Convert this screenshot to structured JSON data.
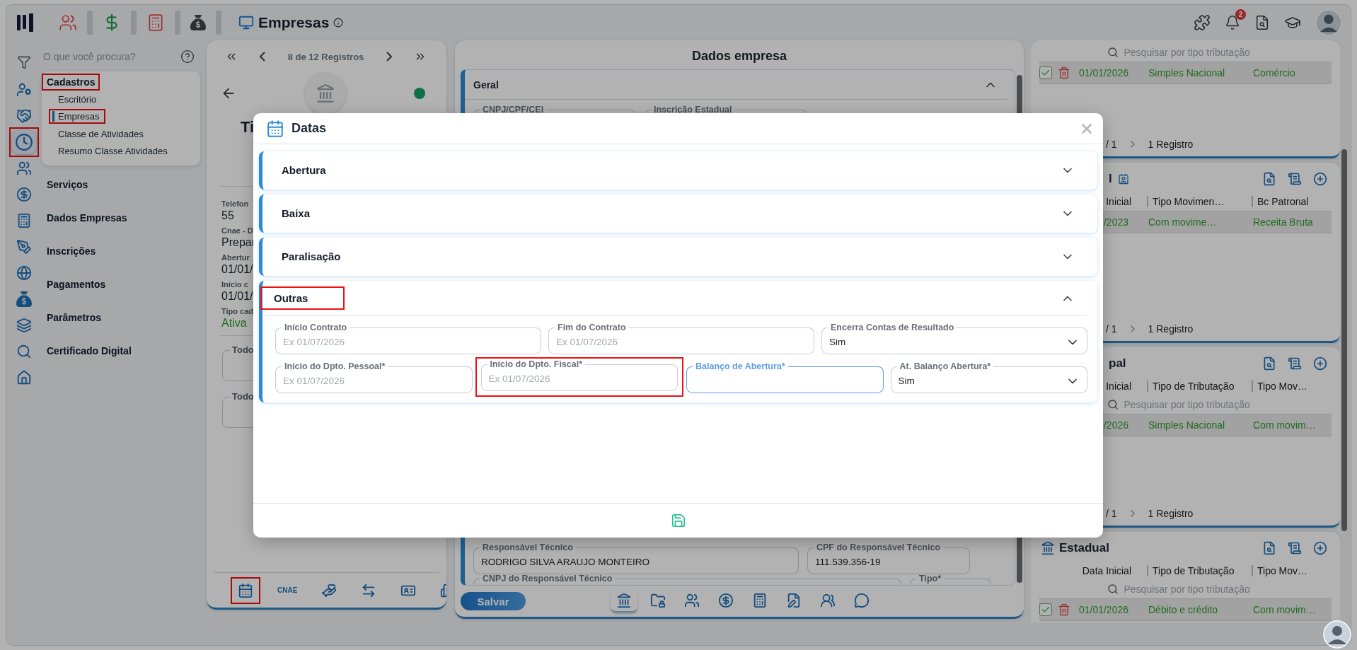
{
  "topbar": {
    "title": "Empresas",
    "notification_count": "2"
  },
  "rail": [
    {
      "kind": "user-gear",
      "selected": false,
      "highlighted": false
    },
    {
      "kind": "handshake",
      "selected": false,
      "highlighted": false
    },
    {
      "kind": "clock",
      "selected": true,
      "highlighted": true
    },
    {
      "kind": "users",
      "selected": false,
      "highlighted": false
    },
    {
      "kind": "dollar",
      "selected": false,
      "highlighted": false
    },
    {
      "kind": "calculator",
      "selected": false,
      "highlighted": false
    },
    {
      "kind": "pen",
      "selected": false,
      "highlighted": false
    },
    {
      "kind": "globe",
      "selected": false,
      "highlighted": false
    },
    {
      "kind": "money-bag",
      "selected": false,
      "highlighted": false
    },
    {
      "kind": "layers",
      "selected": false,
      "highlighted": false
    },
    {
      "kind": "search",
      "selected": false,
      "highlighted": false
    },
    {
      "kind": "home",
      "selected": false,
      "highlighted": false
    }
  ],
  "menu": {
    "search_placeholder": "O que você procura?",
    "items": [
      {
        "label": "Cadastros",
        "expanded": true,
        "highlighted": true,
        "children": [
          {
            "label": "Escritório",
            "selected": false,
            "highlighted": false
          },
          {
            "label": "Empresas",
            "selected": true,
            "highlighted": true
          },
          {
            "label": "Classe de Atividades",
            "selected": false,
            "highlighted": false
          },
          {
            "label": "Resumo Classe Atividades",
            "selected": false,
            "highlighted": false
          }
        ]
      },
      {
        "label": "Serviços",
        "expanded": false,
        "highlighted": false
      },
      {
        "label": "Dados Empresas",
        "expanded": false,
        "highlighted": false
      },
      {
        "label": "Inscrições",
        "expanded": false,
        "highlighted": false
      },
      {
        "label": "Pagamentos",
        "expanded": false,
        "highlighted": false
      },
      {
        "label": "Parâmetros",
        "expanded": false,
        "highlighted": false
      },
      {
        "label": "Certificado Digital",
        "expanded": false,
        "highlighted": false
      }
    ]
  },
  "record_panel": {
    "pager": "8 de 12 Registros",
    "title": "Ti",
    "fields": [
      {
        "label": "Telefon",
        "value": "55",
        "kind": "plain"
      },
      {
        "label": "Cnae - D",
        "value": "Prepar",
        "kind": "plain"
      },
      {
        "label": "Abertur",
        "value": "01/01/",
        "kind": "plain"
      },
      {
        "label": "Início c",
        "value": "01/01/",
        "kind": "plain"
      },
      {
        "label": "Tipo cad",
        "value": "Ativa",
        "kind": "status"
      }
    ],
    "filters": [
      "Todo",
      "Todo"
    ],
    "tools": [
      {
        "kind": "calendar",
        "highlighted": true
      },
      {
        "kind": "text",
        "label": "CNAE",
        "highlighted": false
      },
      {
        "kind": "hand",
        "highlighted": false
      },
      {
        "kind": "swap",
        "highlighted": false
      },
      {
        "kind": "card",
        "highlighted": false
      },
      {
        "kind": "building",
        "highlighted": false
      }
    ]
  },
  "company_panel": {
    "title": "Dados empresa",
    "section": {
      "title": "Geral",
      "expanded": true
    },
    "top_fields": [
      {
        "label": "CNPJ/CPF/CEI"
      },
      {
        "label": "Inscrição Estadual"
      }
    ],
    "bottom_rows": [
      [
        {
          "label": "Responsável Técnico",
          "value": "RODRIGO SILVA ARAUJO MONTEIRO"
        },
        {
          "label": "CPF do Responsável Técnico",
          "value": "111.539.356-19"
        }
      ],
      [
        {
          "label": "CNPJ do Responsável Técnico"
        },
        {
          "label": "Tipo*"
        }
      ]
    ],
    "save_label": "Salvar",
    "tabs": [
      {
        "kind": "bank",
        "selected": true
      },
      {
        "kind": "folder-lock",
        "selected": false
      },
      {
        "kind": "users",
        "selected": false
      },
      {
        "kind": "dollar",
        "selected": false
      },
      {
        "kind": "calculator",
        "selected": false
      },
      {
        "kind": "file-edit",
        "selected": false
      },
      {
        "kind": "group",
        "selected": false
      },
      {
        "kind": "chat",
        "selected": false
      }
    ]
  },
  "right_panel": {
    "sections": [
      {
        "kind": "untitled",
        "search_placeholder": "Pesquisar por tipo tributação",
        "rows": [
          {
            "checked": true,
            "cells": [
              "01/01/2026",
              "Simples Nacional",
              "Comércio"
            ]
          }
        ],
        "pager": {
          "page": "/ 1",
          "count": "1 Registro"
        }
      },
      {
        "kind": "covered-badge",
        "title": "l",
        "columns": [
          "Inicial",
          "Tipo Movimen…",
          "Bc Patronal"
        ],
        "rows": [
          {
            "cells": [
              "/2023",
              "Com movime…",
              "Receita Bruta"
            ]
          }
        ],
        "pager": {
          "page": "/ 1",
          "count": "1 Registro"
        }
      },
      {
        "kind": "covered",
        "title": "pal",
        "columns": [
          "Inicial",
          "Tipo de Tributação",
          "Tipo Mov…"
        ],
        "search_placeholder": "Pesquisar por tipo tributação",
        "rows": [
          {
            "cells": [
              "/2026",
              "Simples Nacional",
              "Com movim…"
            ]
          }
        ],
        "pager": {
          "page": "/ 1",
          "count": "1 Registro"
        }
      },
      {
        "kind": "building",
        "title": "Estadual",
        "columns": [
          "Data Inicial",
          "Tipo de Tributação",
          "Tipo Mov…"
        ],
        "search_placeholder": "Pesquisar por tipo tributação",
        "rows": [
          {
            "checked": true,
            "cells": [
              "01/01/2026",
              "Débito e crédito",
              "Com movim…"
            ]
          }
        ]
      }
    ]
  },
  "modal": {
    "title": "Datas",
    "sections": [
      {
        "title": "Abertura",
        "expanded": false,
        "highlighted": false
      },
      {
        "title": "Baixa",
        "expanded": false,
        "highlighted": false
      },
      {
        "title": "Paralisação",
        "expanded": false,
        "highlighted": false
      },
      {
        "title": "Outras",
        "expanded": true,
        "highlighted": true,
        "field_groups": [
          {
            "fields": [
              {
                "kind": "date",
                "label": "Início Contrato",
                "placeholder": "Ex 01/07/2026",
                "focused": false,
                "highlighted": false
              },
              {
                "kind": "date",
                "label": "Fim do Contrato",
                "placeholder": "Ex 01/07/2026",
                "focused": false,
                "highlighted": false
              },
              {
                "kind": "select",
                "label": "Encerra Contas de Resultado",
                "value": "Sim",
                "focused": false,
                "highlighted": false
              }
            ]
          },
          {
            "fields": [
              {
                "kind": "date",
                "label": "Início do Dpto. Pessoal*",
                "placeholder": "Ex 01/07/2026",
                "focused": false,
                "highlighted": false
              },
              {
                "kind": "date",
                "label": "Início do Dpto. Fiscal*",
                "placeholder": "Ex 01/07/2026",
                "focused": false,
                "highlighted": true
              },
              {
                "kind": "date",
                "label": "Balanço de Abertura*",
                "focused": true,
                "highlighted": false
              },
              {
                "kind": "select",
                "label": "At. Balanço Abertura*",
                "value": "Sim",
                "focused": false,
                "highlighted": false
              }
            ]
          }
        ]
      }
    ]
  }
}
